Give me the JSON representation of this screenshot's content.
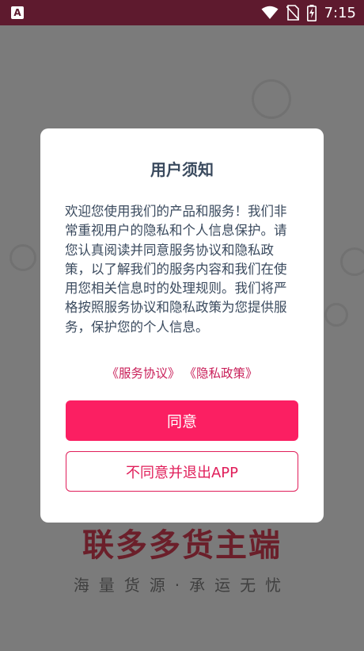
{
  "status_bar": {
    "app_icon_letter": "A",
    "time": "7:15",
    "icons": [
      "wifi-icon",
      "no-sim-icon",
      "battery-charging-icon"
    ]
  },
  "background": {
    "app_title": "联多多货主端",
    "app_subtitle": "海量货源·承运无忧"
  },
  "dialog": {
    "title": "用户须知",
    "body": "欢迎您使用我们的产品和服务！我们非常重视用户的隐私和个人信息保护。请您认真阅读并同意服务协议和隐私政策，以了解我们的服务内容和我们在使用您相关信息时的处理规则。我们将严格按照服务协议和隐私政策为您提供服务，保护您的个人信息。",
    "service_agreement_link": "《服务协议》",
    "privacy_policy_link": "《隐私政策》",
    "agree_button": "同意",
    "disagree_button": "不同意并退出APP"
  },
  "colors": {
    "accent": "#fb1f62",
    "link": "#c9205a",
    "text": "#3a4a5e",
    "status_bar": "#5e1a2e"
  }
}
